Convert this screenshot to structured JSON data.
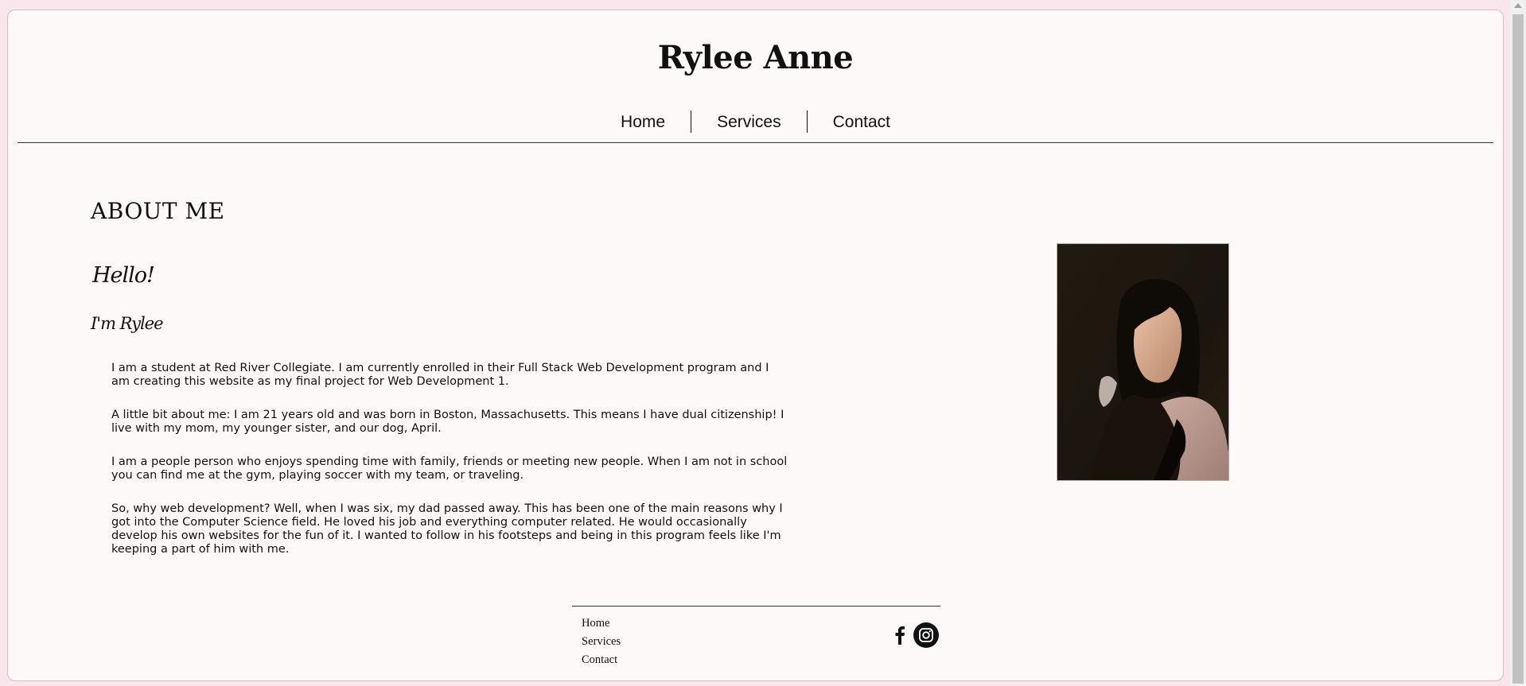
{
  "site": {
    "title": "Rylee Anne"
  },
  "nav": {
    "items": [
      {
        "label": "Home"
      },
      {
        "label": "Services"
      },
      {
        "label": "Contact"
      }
    ]
  },
  "about": {
    "heading": "ABOUT ME",
    "greeting": "Hello!",
    "subgreeting": "I'm Rylee",
    "paragraphs": [
      "I am a student at Red River Collegiate. I am currently enrolled in their Full Stack Web Development program and I am creating this website as my final project for Web Development 1.",
      "A little bit about me: I am 21 years old and was born in Boston, Massachusetts. This means I have dual citizenship! I live with my mom, my younger sister, and our dog, April.",
      "I am a people person who enjoys spending time with family, friends or meeting new people. When I am not in school you can find me at the gym, playing soccer with my team, or traveling.",
      "So, why web development? Well, when I was six, my dad passed away. This has been one of the main reasons why I got into the Computer Science field. He loved his job and everything computer related. He would occasionally develop his own websites for the fun of it. I wanted to follow in his footsteps and being in this program feels like I'm keeping a part of him with me."
    ],
    "photo_icon": "portrait-photo"
  },
  "footer": {
    "links": [
      {
        "label": "Home"
      },
      {
        "label": "Services"
      },
      {
        "label": "Contact"
      }
    ],
    "social": [
      {
        "icon": "facebook-icon"
      },
      {
        "icon": "instagram-icon"
      }
    ]
  },
  "colors": {
    "page_background": "#fdf9f8",
    "outer_background": "#f9e6ec",
    "text": "#111111"
  }
}
